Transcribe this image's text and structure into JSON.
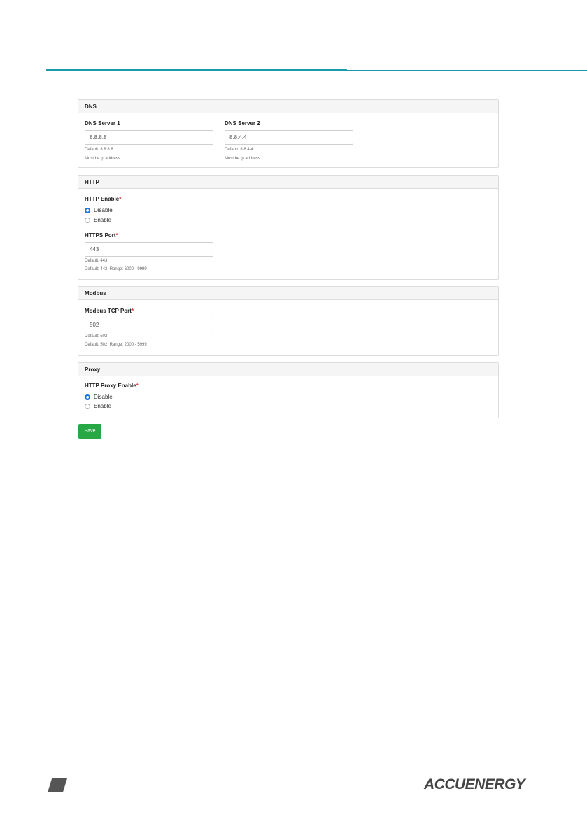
{
  "dns": {
    "title": "DNS",
    "server1_label": "DNS Server 1",
    "server1_value": "8.8.8.8",
    "server1_default": "Default: 8.8.8.8",
    "server1_rule": "Must be ip address",
    "server2_label": "DNS Server 2",
    "server2_value": "8.8.4.4",
    "server2_default": "Default: 8.8.4.4",
    "server2_rule": "Must be ip address"
  },
  "http": {
    "title": "HTTP",
    "enable_label": "HTTP Enable",
    "required_mark": "*",
    "options": [
      "Disable",
      "Enable"
    ],
    "selected": "Disable",
    "port_label": "HTTPS Port",
    "port_value": "443",
    "port_default": "Default: 443",
    "port_range": "Default: 443, Range: 6000 - 9999"
  },
  "modbus": {
    "title": "Modbus",
    "port_label": "Modbus TCP Port",
    "required_mark": "*",
    "port_value": "502",
    "port_default": "Default: 502",
    "port_range": "Default: 502, Range: 2000 - 5999"
  },
  "proxy": {
    "title": "Proxy",
    "enable_label": "HTTP Proxy Enable",
    "required_mark": "*",
    "options": [
      "Disable",
      "Enable"
    ],
    "selected": "Disable"
  },
  "actions": {
    "save_label": "Save"
  },
  "footer": {
    "brand": "ACCUENERGY"
  },
  "colors": {
    "accent_rule": "#1a9bab",
    "save_button": "#28a745",
    "radio_checked": "#1a73e8",
    "required": "#d9363e"
  }
}
